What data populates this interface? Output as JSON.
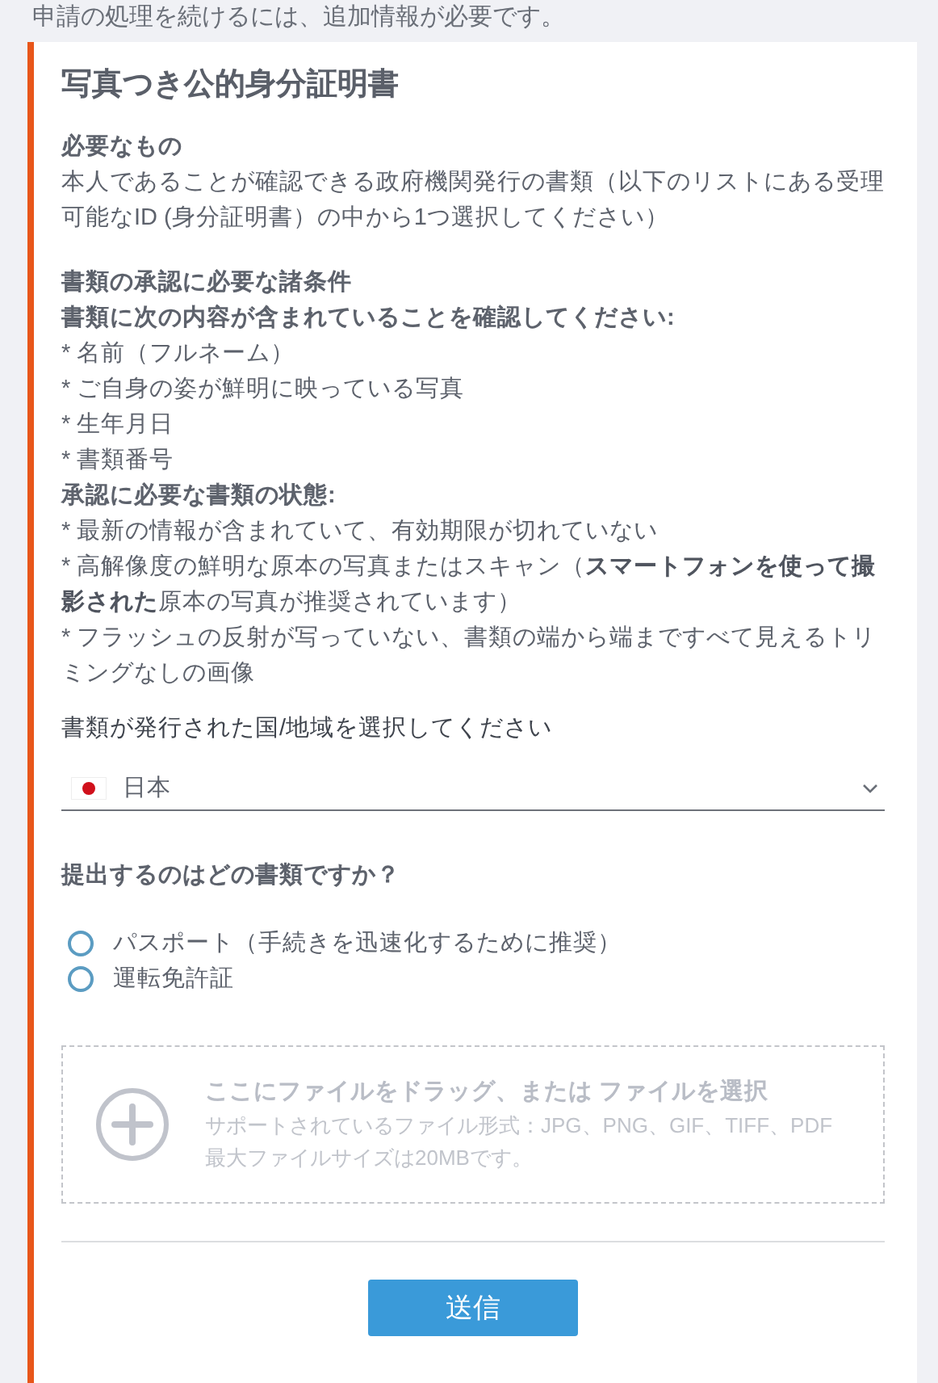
{
  "notice": "申請の処理を続けるには、追加情報が必要です。",
  "card": {
    "title": "写真つき公的身分証明書",
    "groups": [
      {
        "blocks": [
          {
            "kind": "heading",
            "text": "必要なもの"
          },
          {
            "kind": "text",
            "text": "本人であることが確認できる政府機関発行の書類（以下のリストにある受理可能なID (身分証明書）の中から1つ選択してください）"
          }
        ]
      },
      {
        "blocks": [
          {
            "kind": "heading",
            "text": "書類の承認に必要な諸条件"
          },
          {
            "kind": "heading",
            "text": "書類に次の内容が含まれていることを確認してください:"
          },
          {
            "kind": "text",
            "text": "* 名前（フルネーム）"
          },
          {
            "kind": "text",
            "text": "* ご自身の姿が鮮明に映っている写真"
          },
          {
            "kind": "text",
            "text": "* 生年月日"
          },
          {
            "kind": "text",
            "text": "* 書類番号"
          },
          {
            "kind": "heading",
            "text": "承認に必要な書類の状態:"
          },
          {
            "kind": "text",
            "text": "* 最新の情報が含まれていて、有効期限が切れていない"
          },
          {
            "kind": "text",
            "text": "* 高解像度の鮮明な原本の写真またはスキャン（**スマートフォンを使って撮影された**原本の写真が推奨されています）"
          },
          {
            "kind": "text",
            "text": "* フラッシュの反射が写っていない、書類の端から端まですべて見えるトリミングなしの画像"
          }
        ]
      }
    ],
    "country": {
      "label": "書類が発行された国/地域を選択してください",
      "value": "日本"
    },
    "question": "提出するのはどの書類ですか？",
    "options": [
      {
        "label": "パスポート（手続きを迅速化するために推奨）",
        "selected": false
      },
      {
        "label": "運転免許証",
        "selected": false
      }
    ],
    "upload": {
      "title": "ここにファイルをドラッグ、または ファイルを選択",
      "formats": "サポートされているファイル形式：JPG、PNG、GIF、TIFF、PDF",
      "max_size": "最大ファイルサイズは20MBです。"
    },
    "submit": "送信"
  }
}
